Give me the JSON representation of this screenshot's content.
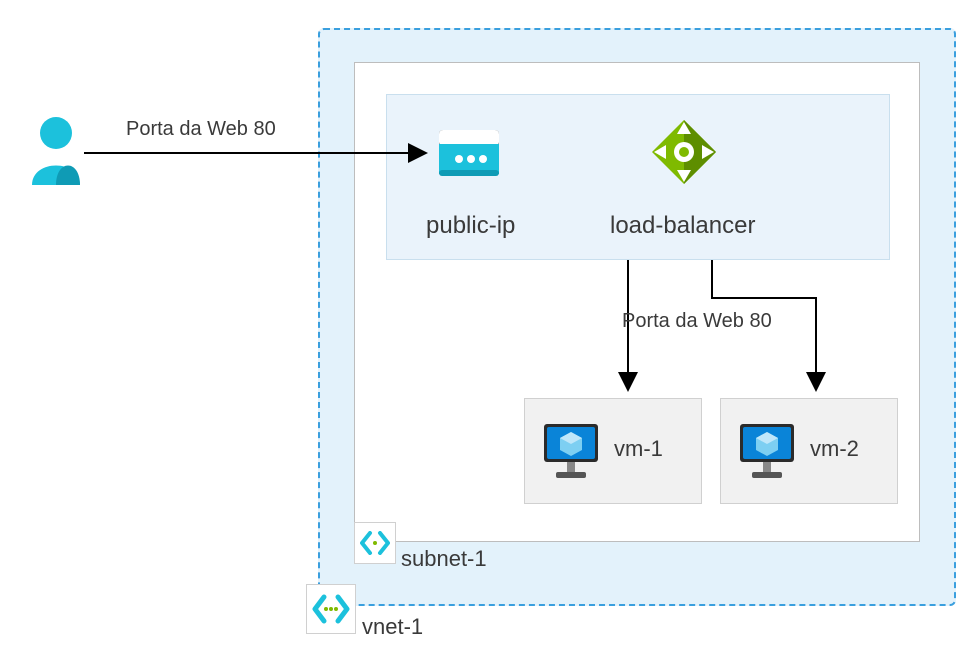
{
  "arrow1_label": "Porta da Web 80",
  "arrow2_label": "Porta da Web 80",
  "public_ip_label": "public-ip",
  "lb_label": "load-balancer",
  "vm1_label": "vm-1",
  "vm2_label": "vm-2",
  "subnet_label": "subnet-1",
  "vnet_label": "vnet-1",
  "colors": {
    "azure_cyan": "#1cc1dc",
    "azure_cyan_dark": "#0f9bb5",
    "lb_green": "#7fba00",
    "lb_green_dark": "#5e8e00",
    "vm_blue": "#0a84d8",
    "vnet_border": "#3a9fde"
  }
}
